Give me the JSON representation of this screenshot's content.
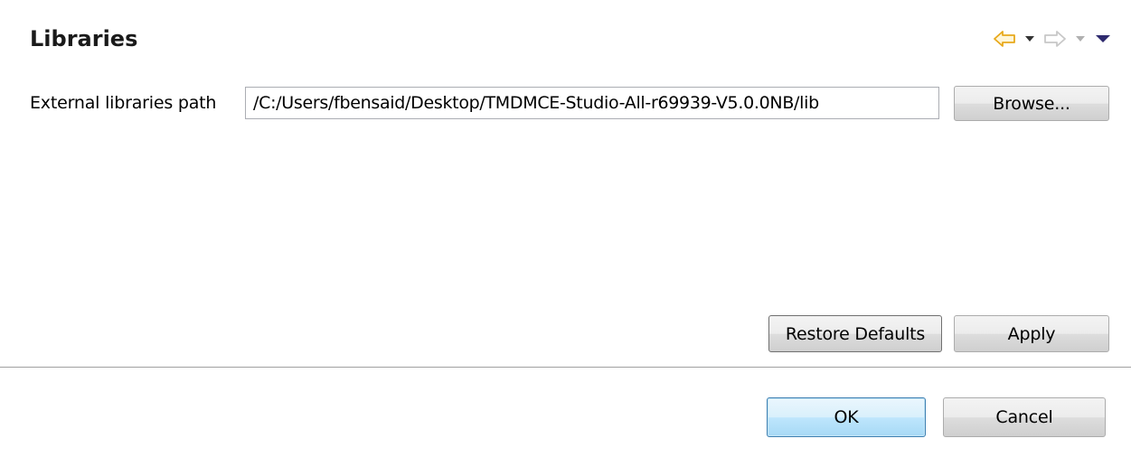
{
  "header": {
    "title": "Libraries",
    "nav": {
      "back_icon": "back-arrow-icon",
      "back_menu_icon": "chevron-down-icon",
      "forward_icon": "forward-arrow-icon",
      "forward_menu_icon": "chevron-down-icon",
      "view_menu_icon": "view-menu-icon"
    }
  },
  "form": {
    "path_label": "External libraries path",
    "path_value": "/C:/Users/fbensaid/Desktop/TMDMCE-Studio-All-r69939-V5.0.0NB/lib",
    "browse_label": "Browse..."
  },
  "page_buttons": {
    "restore_label": "Restore Defaults",
    "apply_label": "Apply"
  },
  "dialog_buttons": {
    "ok_label": "OK",
    "cancel_label": "Cancel"
  },
  "colors": {
    "back_arrow": "#e8a91c",
    "disabled_arrow": "#c8c8c8",
    "menu_arrow": "#2e2a6e",
    "ok_border": "#3c7fb1"
  }
}
